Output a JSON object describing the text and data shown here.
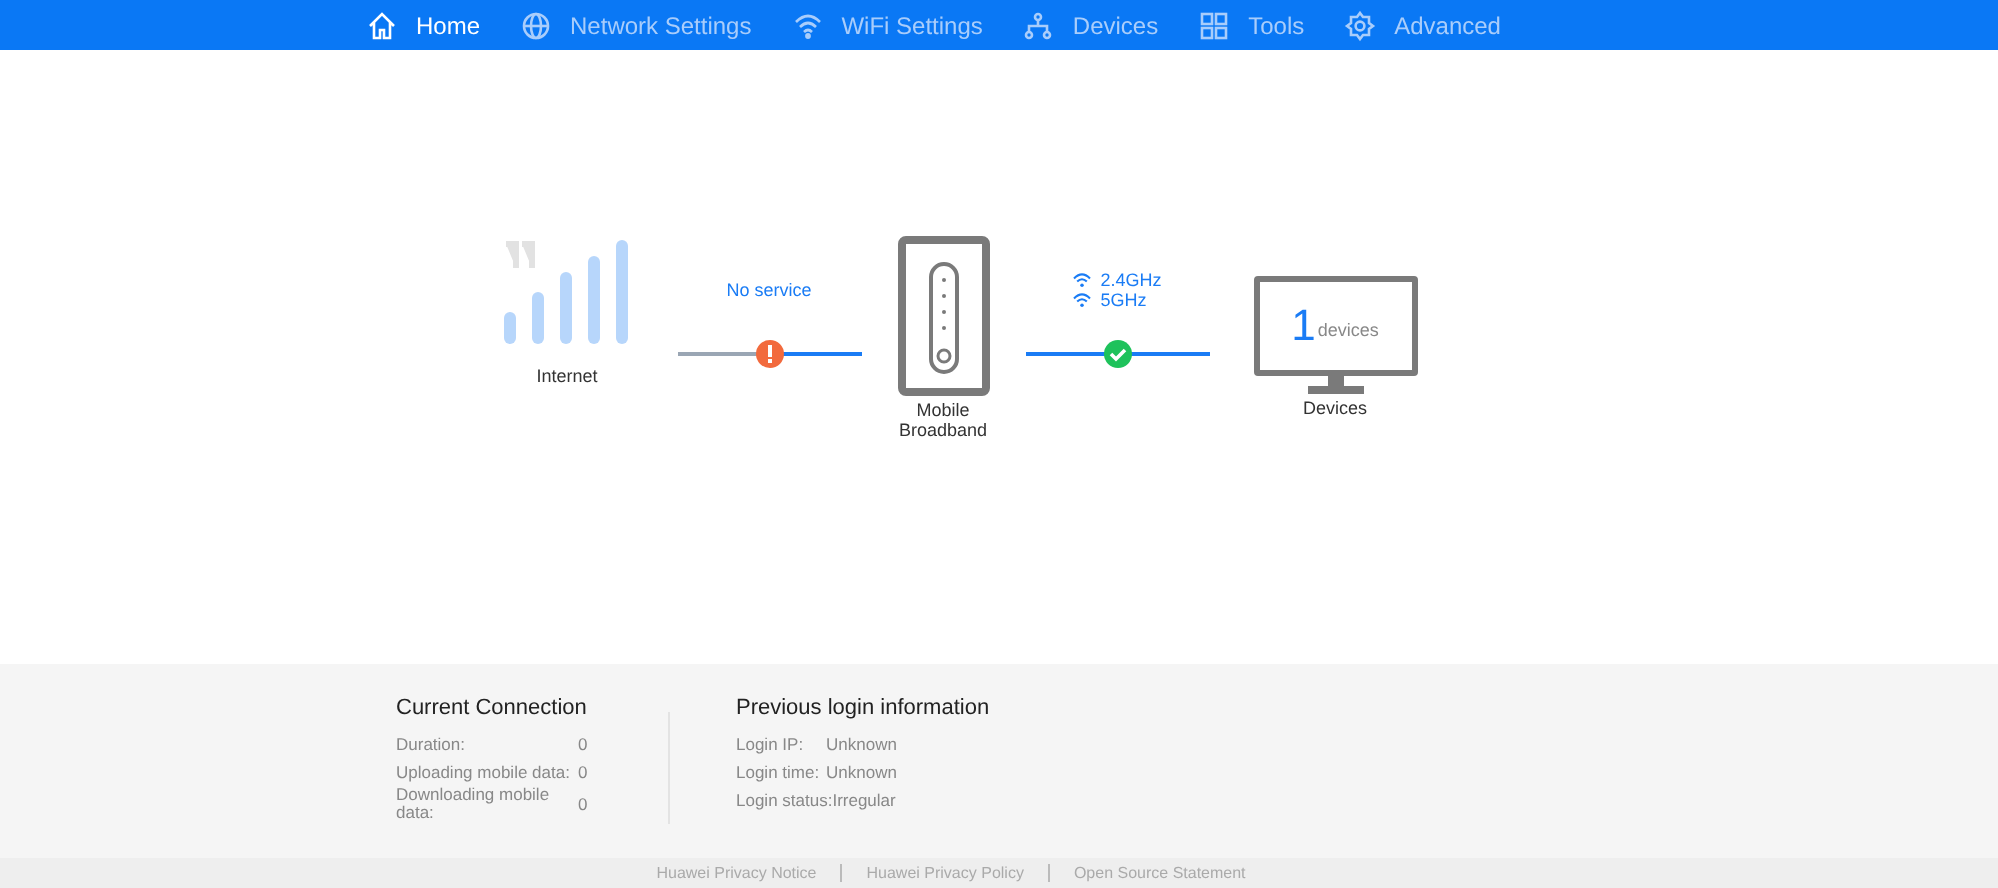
{
  "nav": [
    {
      "label": "Home",
      "selected": true
    },
    {
      "label": "Network Settings",
      "selected": false
    },
    {
      "label": "WiFi Settings",
      "selected": false
    },
    {
      "label": "Devices",
      "selected": false
    },
    {
      "label": "Tools",
      "selected": false
    },
    {
      "label": "Advanced",
      "selected": false
    }
  ],
  "topology": {
    "internet": {
      "label": "Internet"
    },
    "internet_link": {
      "connected": false,
      "text": "No service"
    },
    "router": {
      "label": "Mobile Broadband"
    },
    "wifi_link": {
      "connected": true,
      "bands": [
        "2.4GHz",
        "5GHz"
      ]
    },
    "devices": {
      "count": "1",
      "unit": "devices",
      "label": "Devices"
    }
  },
  "current_connection": {
    "title": "Current Connection",
    "rows": [
      {
        "label": "Duration:",
        "value": "0"
      },
      {
        "label": "Uploading mobile data:",
        "value": "0"
      },
      {
        "label": "Downloading mobile data:",
        "value": "0"
      }
    ]
  },
  "previous_login": {
    "title": "Previous login information",
    "rows": [
      {
        "label": "Login IP:",
        "value": "Unknown"
      },
      {
        "label": "Login time:",
        "value": "Unknown"
      },
      {
        "label": "Login status:",
        "value": "Irregular"
      }
    ]
  },
  "footer_links": [
    "Huawei Privacy Notice",
    "Huawei Privacy Policy",
    "Open Source Statement"
  ]
}
